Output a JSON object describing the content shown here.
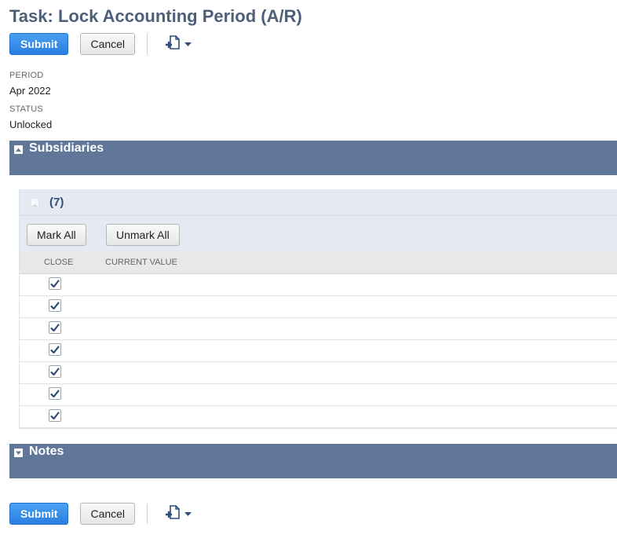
{
  "page": {
    "title": "Task: Lock Accounting Period (A/R)"
  },
  "toolbar": {
    "submit_label": "Submit",
    "cancel_label": "Cancel",
    "action_icon": "new-record-icon",
    "dropdown_icon": "caret-down-icon"
  },
  "fields": {
    "period": {
      "label": "PERIOD",
      "value": "Apr 2022"
    },
    "status": {
      "label": "STATUS",
      "value": "Unlocked"
    }
  },
  "subsidiaries": {
    "section_label": "Subsidiaries",
    "count_label": "(7)",
    "mark_all_label": "Mark All",
    "unmark_all_label": "Unmark All",
    "columns": [
      "CLOSE",
      "CURRENT VALUE"
    ],
    "rows": [
      {
        "close": true,
        "current_value": ""
      },
      {
        "close": true,
        "current_value": ""
      },
      {
        "close": true,
        "current_value": ""
      },
      {
        "close": true,
        "current_value": ""
      },
      {
        "close": true,
        "current_value": ""
      },
      {
        "close": true,
        "current_value": ""
      },
      {
        "close": true,
        "current_value": ""
      }
    ]
  },
  "notes": {
    "section_label": "Notes"
  },
  "colors": {
    "title": "#4d5f79",
    "primary_button": "#2a7fe0",
    "section_bar": "#607799",
    "sublist_header": "#e5e9f1",
    "count_text": "#2f4d7a",
    "checkmark": "#2b4a7c"
  }
}
